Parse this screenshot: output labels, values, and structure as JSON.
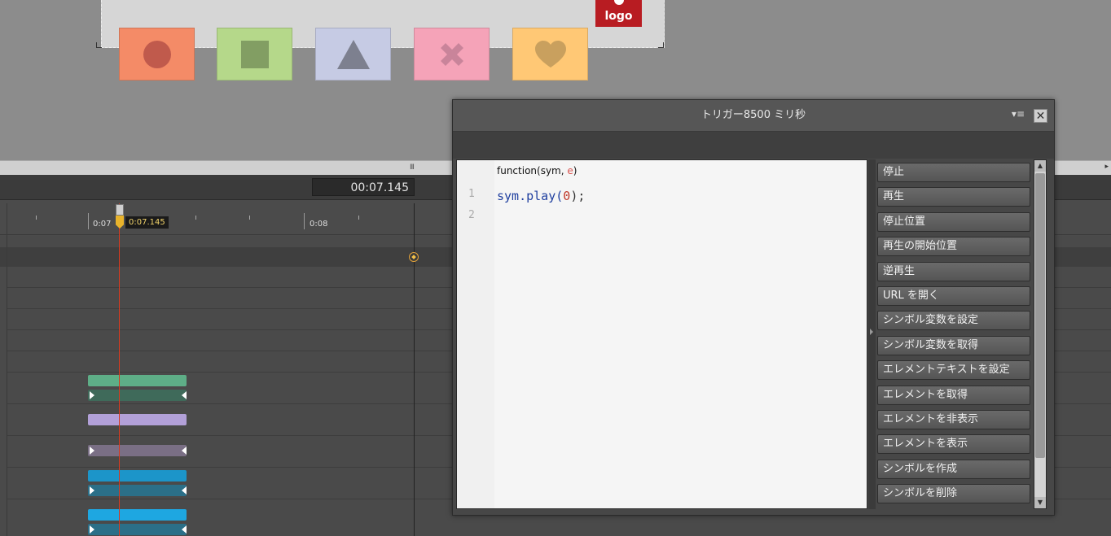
{
  "stage": {
    "logo_text": "logo",
    "buttons": [
      {
        "icon": "circle-icon",
        "bg": "#f48b67",
        "fg": "#c05a4c"
      },
      {
        "icon": "square-icon",
        "bg": "#b5d88a",
        "fg": "#829e63"
      },
      {
        "icon": "triangle-icon",
        "bg": "#c6cbe4",
        "fg": "#7d808f"
      },
      {
        "icon": "x-icon",
        "bg": "#f5a3b8",
        "fg": "#c9849a"
      },
      {
        "icon": "heart-icon",
        "bg": "#ffc875",
        "fg": "#c9a05e"
      }
    ]
  },
  "timeline": {
    "current_time": "00:07.145",
    "ruler_labels": [
      "0:07",
      "0:08"
    ],
    "playhead_label": "0:07.145",
    "bars": [
      {
        "color": "#5eae87",
        "row": 0
      },
      {
        "color": "#3f6a5a",
        "row": 1
      },
      {
        "color": "#b2a0d8",
        "row": 2
      },
      {
        "color": "#7a6f85",
        "row": 3
      },
      {
        "color": "#1c95c9",
        "row": 4
      },
      {
        "color": "#2b6f88",
        "row": 5
      },
      {
        "color": "#1ea7e1",
        "row": 6
      },
      {
        "color": "#2b6f88",
        "row": 7
      }
    ]
  },
  "panel": {
    "title": "トリガー8500 ミリ秒",
    "menu_icon": "panel-menu-icon",
    "close_label": "✕",
    "editor": {
      "signature_prefix": "function(sym, ",
      "signature_param": "e",
      "signature_suffix": ")",
      "line_numbers": [
        "1",
        "2"
      ],
      "code_obj": "sym.play(",
      "code_num": "0",
      "code_end": ");"
    },
    "actions": [
      "停止",
      "再生",
      "停止位置",
      "再生の開始位置",
      "逆再生",
      "URL を開く",
      "シンボル変数を設定",
      "シンボル変数を取得",
      "エレメントテキストを設定",
      "エレメントを取得",
      "エレメントを非表示",
      "エレメントを表示",
      "シンボルを作成",
      "シンボルを削除"
    ]
  }
}
